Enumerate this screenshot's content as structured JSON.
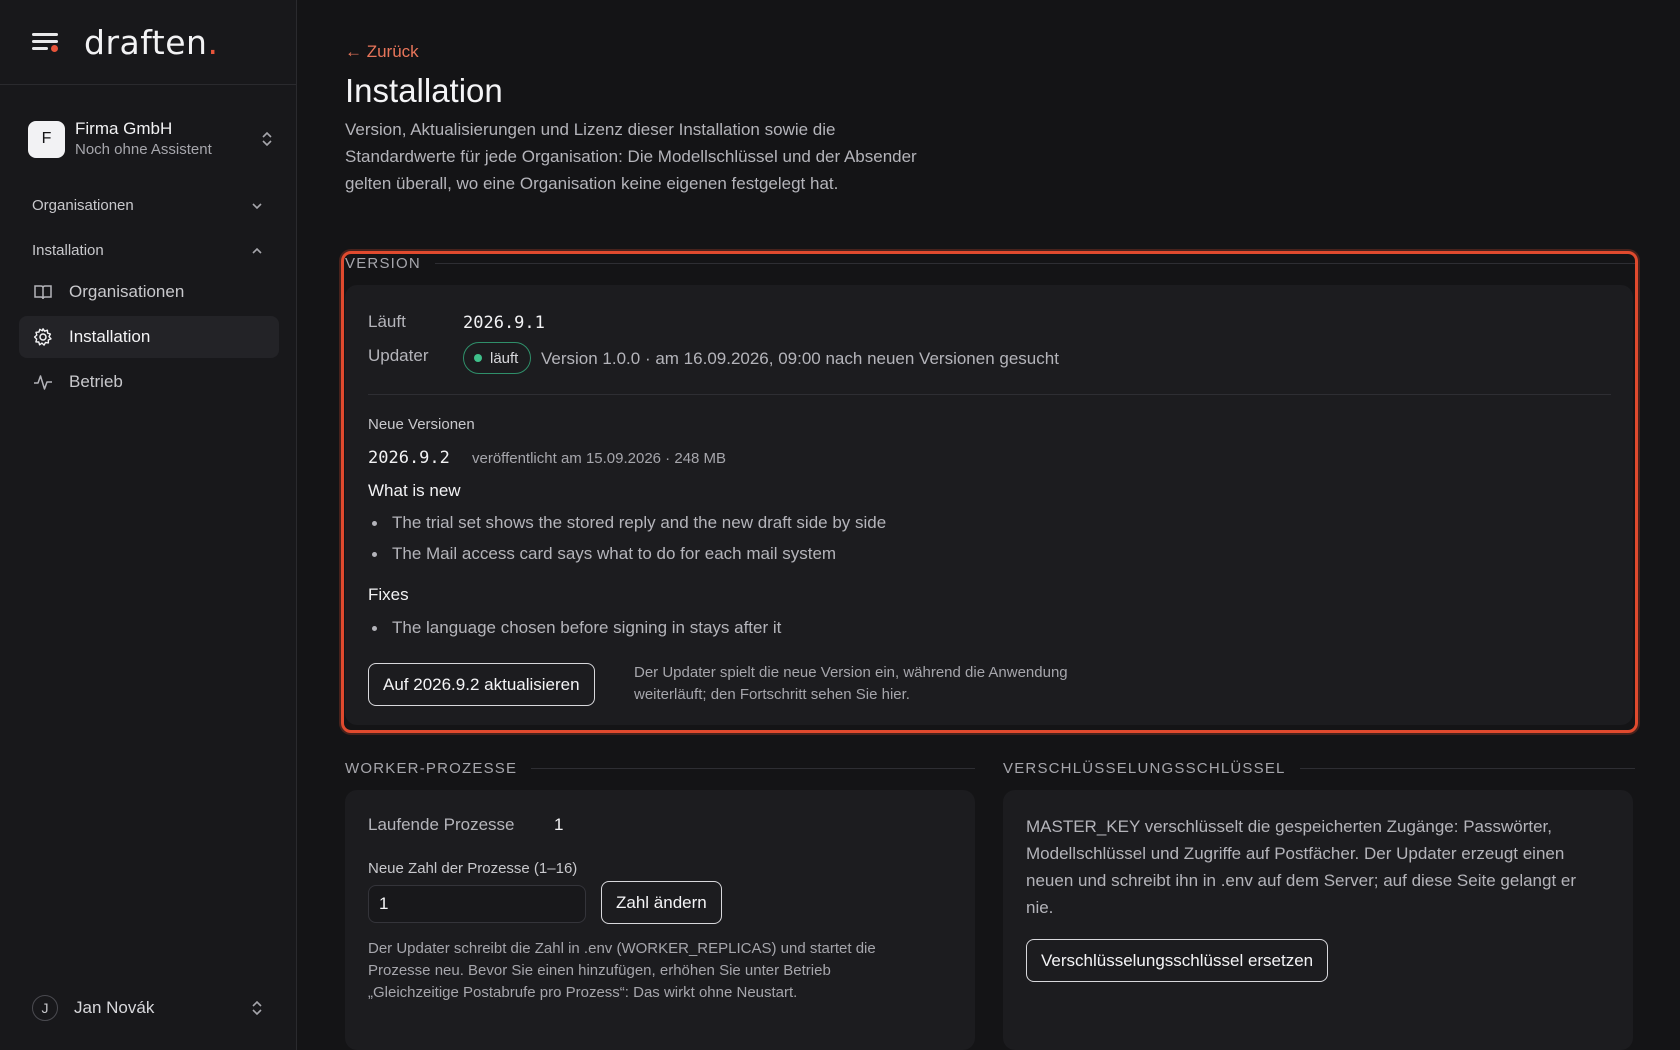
{
  "sidebar": {
    "brand": "draften",
    "brand_dot": ".",
    "org": {
      "initial": "F",
      "name": "Firma GmbH",
      "subtitle": "Noch ohne Assistent"
    },
    "groups": [
      {
        "label": "Organisationen"
      },
      {
        "label": "Installation"
      }
    ],
    "items": [
      {
        "label": "Organisationen",
        "icon": "book-icon"
      },
      {
        "label": "Installation",
        "icon": "gear-icon"
      },
      {
        "label": "Betrieb",
        "icon": "activity-icon"
      }
    ],
    "user": {
      "initial": "J",
      "name": "Jan Novák"
    }
  },
  "header": {
    "back": "← Zurück",
    "title": "Installation",
    "description": "Version, Aktualisierungen und Lizenz dieser Installation sowie die Standardwerte für jede Organisation: Die Modellschlüssel und der Absender gelten überall, wo eine Organisation keine eigenen festgelegt hat."
  },
  "version": {
    "section_label": "VERSION",
    "running_label": "Läuft",
    "running_value": "2026.9.1",
    "updater_label": "Updater",
    "updater_status": "läuft",
    "updater_info": "Version 1.0.0 · am 16.09.2026, 09:00 nach neuen Versionen gesucht",
    "new_versions_label": "Neue Versionen",
    "new_version": "2026.9.2",
    "new_version_meta": "veröffentlicht am 15.09.2026 · 248 MB",
    "whats_new_title": "What is new",
    "whats_new": [
      "The trial set shows the stored reply and the new draft side by side",
      "The Mail access card says what to do for each mail system"
    ],
    "fixes_title": "Fixes",
    "fixes": [
      "The language chosen before signing in stays after it"
    ],
    "update_button": "Auf 2026.9.2 aktualisieren",
    "update_hint": "Der Updater spielt die neue Version ein, während die Anwendung weiterläuft; den Fortschritt sehen Sie hier."
  },
  "workers": {
    "section_label": "WORKER-PROZESSE",
    "running_label": "Laufende Prozesse",
    "running_value": "1",
    "field_label": "Neue Zahl der Prozesse (1–16)",
    "field_value": "1",
    "button": "Zahl ändern",
    "hint": "Der Updater schreibt die Zahl in .env (WORKER_REPLICAS) und startet die Prozesse neu. Bevor Sie einen hinzufügen, erhöhen Sie unter Betrieb „Gleichzeitige Postabrufe pro Prozess“: Das wirkt ohne Neustart."
  },
  "encryption": {
    "section_label": "VERSCHLÜSSELUNGSSCHLÜSSEL",
    "text": "MASTER_KEY verschlüsselt die gespeicherten Zugänge: Passwörter, Modellschlüssel und Zugriffe auf Postfächer. Der Updater erzeugt einen neuen und schreibt ihn in .env auf dem Server; auf diese Seite gelangt er nie.",
    "button": "Verschlüsselungsschlüssel ersetzen"
  },
  "colors": {
    "accent": "#e8543a",
    "highlight": "#e04a2e",
    "success": "#3fbf8a"
  }
}
